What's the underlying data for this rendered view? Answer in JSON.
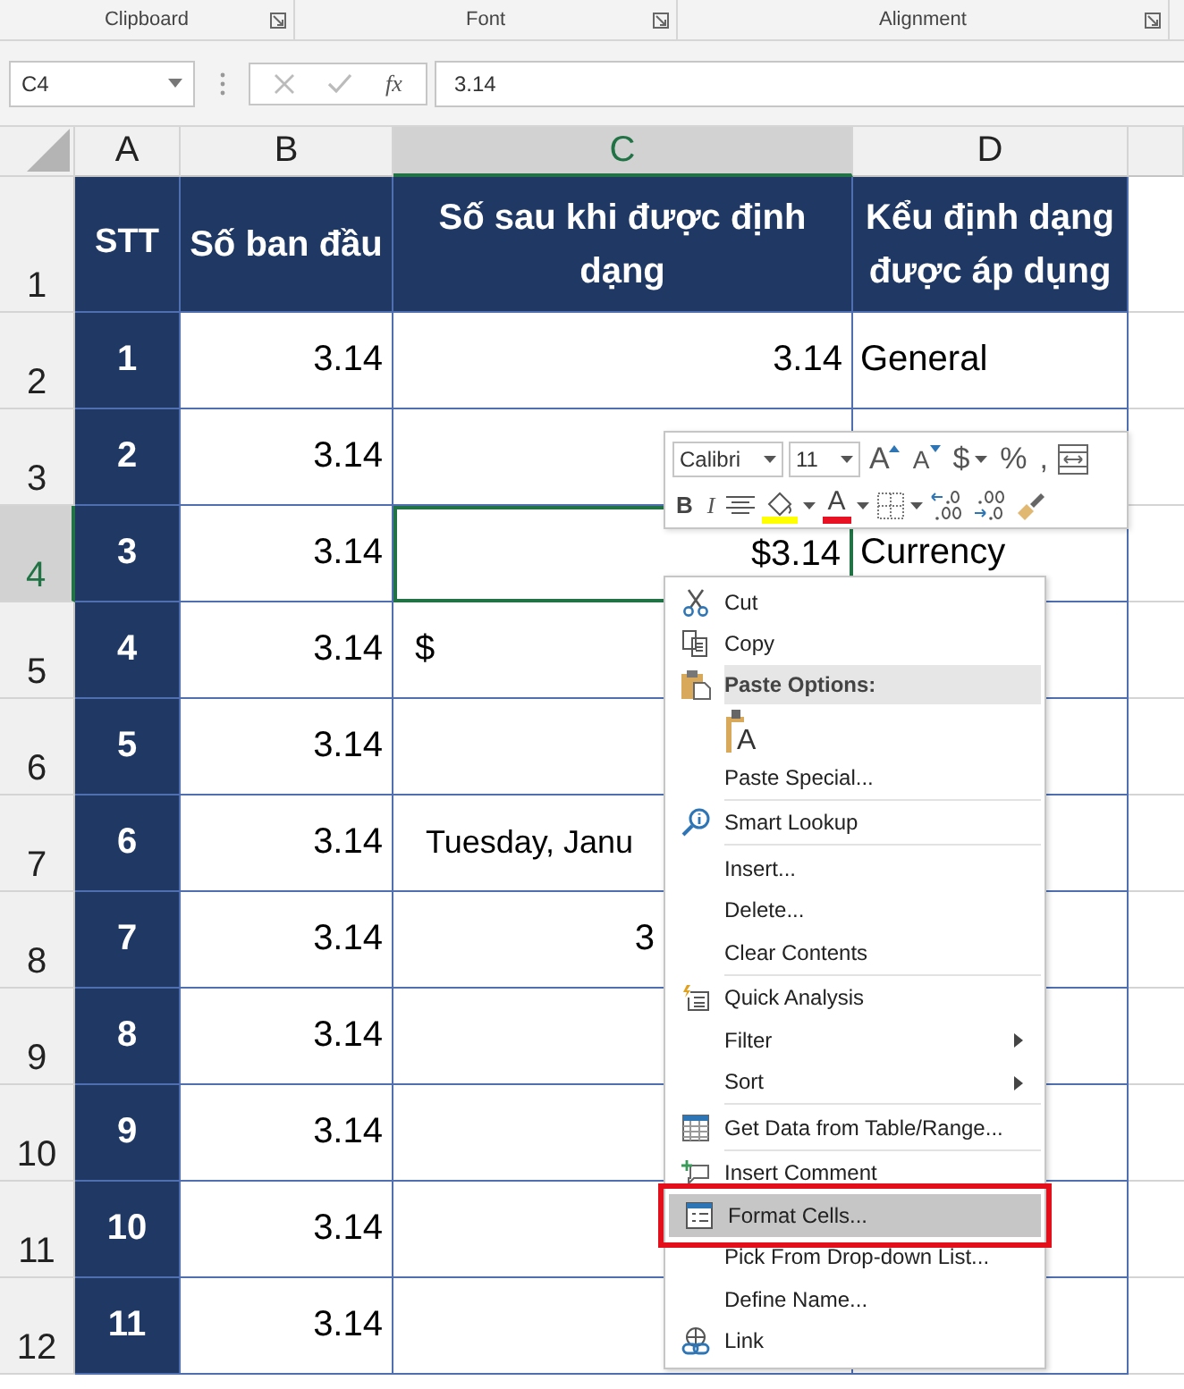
{
  "ribbon_groups": [
    {
      "label": "Clipboard"
    },
    {
      "label": "Font"
    },
    {
      "label": "Alignment"
    }
  ],
  "formula_bar": {
    "name_box": "C4",
    "fx": "fx",
    "value": "3.14"
  },
  "columns": [
    {
      "label": "A",
      "selected": false
    },
    {
      "label": "B",
      "selected": false
    },
    {
      "label": "C",
      "selected": true
    },
    {
      "label": "D",
      "selected": false
    }
  ],
  "header_row": {
    "row_label": "1",
    "selected": false,
    "cells": [
      "STT",
      "Số ban đầu",
      "Số sau khi được định dạng",
      "Kểu định dạng được áp dụng"
    ]
  },
  "rows": [
    {
      "row_label": "2",
      "selected": false,
      "stt": "1",
      "original": "3.14",
      "formatted": "3.14",
      "kind": "right",
      "format_name": "General"
    },
    {
      "row_label": "3",
      "selected": false,
      "stt": "2",
      "original": "3.14"
    },
    {
      "row_label": "4",
      "selected": true,
      "stt": "3",
      "original": "3.14",
      "formatted": "$3.14",
      "kind": "right",
      "format_name": "Currency"
    },
    {
      "row_label": "5",
      "selected": false,
      "stt": "4",
      "original": "3.14",
      "formatted": "$",
      "kind": "left"
    },
    {
      "row_label": "6",
      "selected": false,
      "stt": "5",
      "original": "3.14"
    },
    {
      "row_label": "7",
      "selected": false,
      "stt": "6",
      "original": "3.14",
      "formatted": "Tuesday, Janu",
      "kind": "indent"
    },
    {
      "row_label": "8",
      "selected": false,
      "stt": "7",
      "original": "3.14",
      "formatted": "3",
      "kind": "center"
    },
    {
      "row_label": "9",
      "selected": false,
      "stt": "8",
      "original": "3.14"
    },
    {
      "row_label": "10",
      "selected": false,
      "stt": "9",
      "original": "3.14"
    },
    {
      "row_label": "11",
      "selected": false,
      "stt": "10",
      "original": "3.14"
    },
    {
      "row_label": "12",
      "selected": false,
      "stt": "11",
      "original": "3.14"
    }
  ],
  "mini_toolbar": {
    "font_name": "Calibri",
    "font_size": "11",
    "row1": [
      {
        "kind": "grow",
        "label": "A"
      },
      {
        "kind": "shrink",
        "label": "A"
      },
      {
        "kind": "text",
        "label": "$",
        "dropdown": true
      },
      {
        "kind": "text",
        "label": "%"
      },
      {
        "kind": "text",
        "label": ","
      },
      {
        "kind": "wrap"
      }
    ],
    "row2": [
      {
        "kind": "bold",
        "label": "B"
      },
      {
        "kind": "italic",
        "label": "I"
      },
      {
        "kind": "align"
      },
      {
        "kind": "fill",
        "dropdown": true,
        "color": "#ffff00"
      },
      {
        "kind": "font_color",
        "label": "A",
        "dropdown": true,
        "color": "#e81123"
      },
      {
        "kind": "borders",
        "dropdown": true
      },
      {
        "kind": "inc_decimal"
      },
      {
        "kind": "dec_decimal"
      },
      {
        "kind": "painter"
      }
    ]
  },
  "context_menu": [
    {
      "kind": "item",
      "label": "Cut",
      "selected": false,
      "boxed": false,
      "submenu": false
    },
    {
      "kind": "item",
      "label": "Copy",
      "selected": false,
      "boxed": false,
      "submenu": false
    },
    {
      "kind": "header",
      "label": "Paste Options:"
    },
    {
      "kind": "paste_icons",
      "label": "A"
    },
    {
      "kind": "item",
      "label": "Paste Special...",
      "selected": false,
      "boxed": false,
      "submenu": false
    },
    {
      "kind": "separator"
    },
    {
      "kind": "item",
      "label": "Smart Lookup",
      "selected": false,
      "boxed": false,
      "submenu": false
    },
    {
      "kind": "separator"
    },
    {
      "kind": "item",
      "label": "Insert...",
      "selected": false,
      "boxed": false,
      "submenu": false
    },
    {
      "kind": "item",
      "label": "Delete...",
      "selected": false,
      "boxed": false,
      "submenu": false
    },
    {
      "kind": "item",
      "label": "Clear Contents",
      "selected": false,
      "boxed": false,
      "submenu": false
    },
    {
      "kind": "separator"
    },
    {
      "kind": "item",
      "label": "Quick Analysis",
      "selected": false,
      "boxed": false,
      "submenu": false
    },
    {
      "kind": "item",
      "label": "Filter",
      "selected": false,
      "boxed": false,
      "submenu": true
    },
    {
      "kind": "item",
      "label": "Sort",
      "selected": false,
      "boxed": false,
      "submenu": true
    },
    {
      "kind": "separator"
    },
    {
      "kind": "item",
      "label": "Get Data from Table/Range...",
      "selected": false,
      "boxed": false,
      "submenu": false
    },
    {
      "kind": "separator"
    },
    {
      "kind": "item",
      "label": "Insert Comment",
      "selected": false,
      "boxed": false,
      "submenu": false
    },
    {
      "kind": "item",
      "label": "Format Cells...",
      "selected": true,
      "boxed": true,
      "submenu": false
    },
    {
      "kind": "item",
      "label": "Pick From Drop-down List...",
      "selected": false,
      "boxed": false,
      "submenu": false
    },
    {
      "kind": "item",
      "label": "Define Name...",
      "selected": false,
      "boxed": false,
      "submenu": false
    },
    {
      "kind": "item",
      "label": "Link",
      "selected": false,
      "boxed": false,
      "submenu": false
    }
  ]
}
